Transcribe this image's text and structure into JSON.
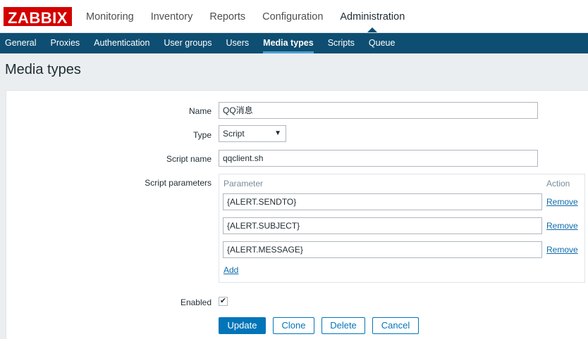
{
  "header": {
    "logo_text": "ZABBIX",
    "main_menu": [
      "Monitoring",
      "Inventory",
      "Reports",
      "Configuration",
      "Administration"
    ],
    "active_main": "Administration",
    "sub_menu": [
      "General",
      "Proxies",
      "Authentication",
      "User groups",
      "Users",
      "Media types",
      "Scripts",
      "Queue"
    ],
    "active_sub": "Media types"
  },
  "page": {
    "title": "Media types"
  },
  "form": {
    "name_label": "Name",
    "name_value": "QQ消息",
    "type_label": "Type",
    "type_value": "Script",
    "script_name_label": "Script name",
    "script_name_value": "qqclient.sh",
    "script_params_label": "Script parameters",
    "params_header_parameter": "Parameter",
    "params_header_action": "Action",
    "params": [
      {
        "value": "{ALERT.SENDTO}",
        "action": "Remove"
      },
      {
        "value": "{ALERT.SUBJECT}",
        "action": "Remove"
      },
      {
        "value": "{ALERT.MESSAGE}",
        "action": "Remove"
      }
    ],
    "add_label": "Add",
    "enabled_label": "Enabled",
    "enabled": true,
    "check_glyph": "✔"
  },
  "buttons": {
    "update": "Update",
    "clone": "Clone",
    "delete": "Delete",
    "cancel": "Cancel"
  },
  "colors": {
    "brand_red": "#d40000",
    "nav_blue": "#0e4e72",
    "link_blue": "#0d6cab",
    "primary_button": "#0275b8"
  }
}
